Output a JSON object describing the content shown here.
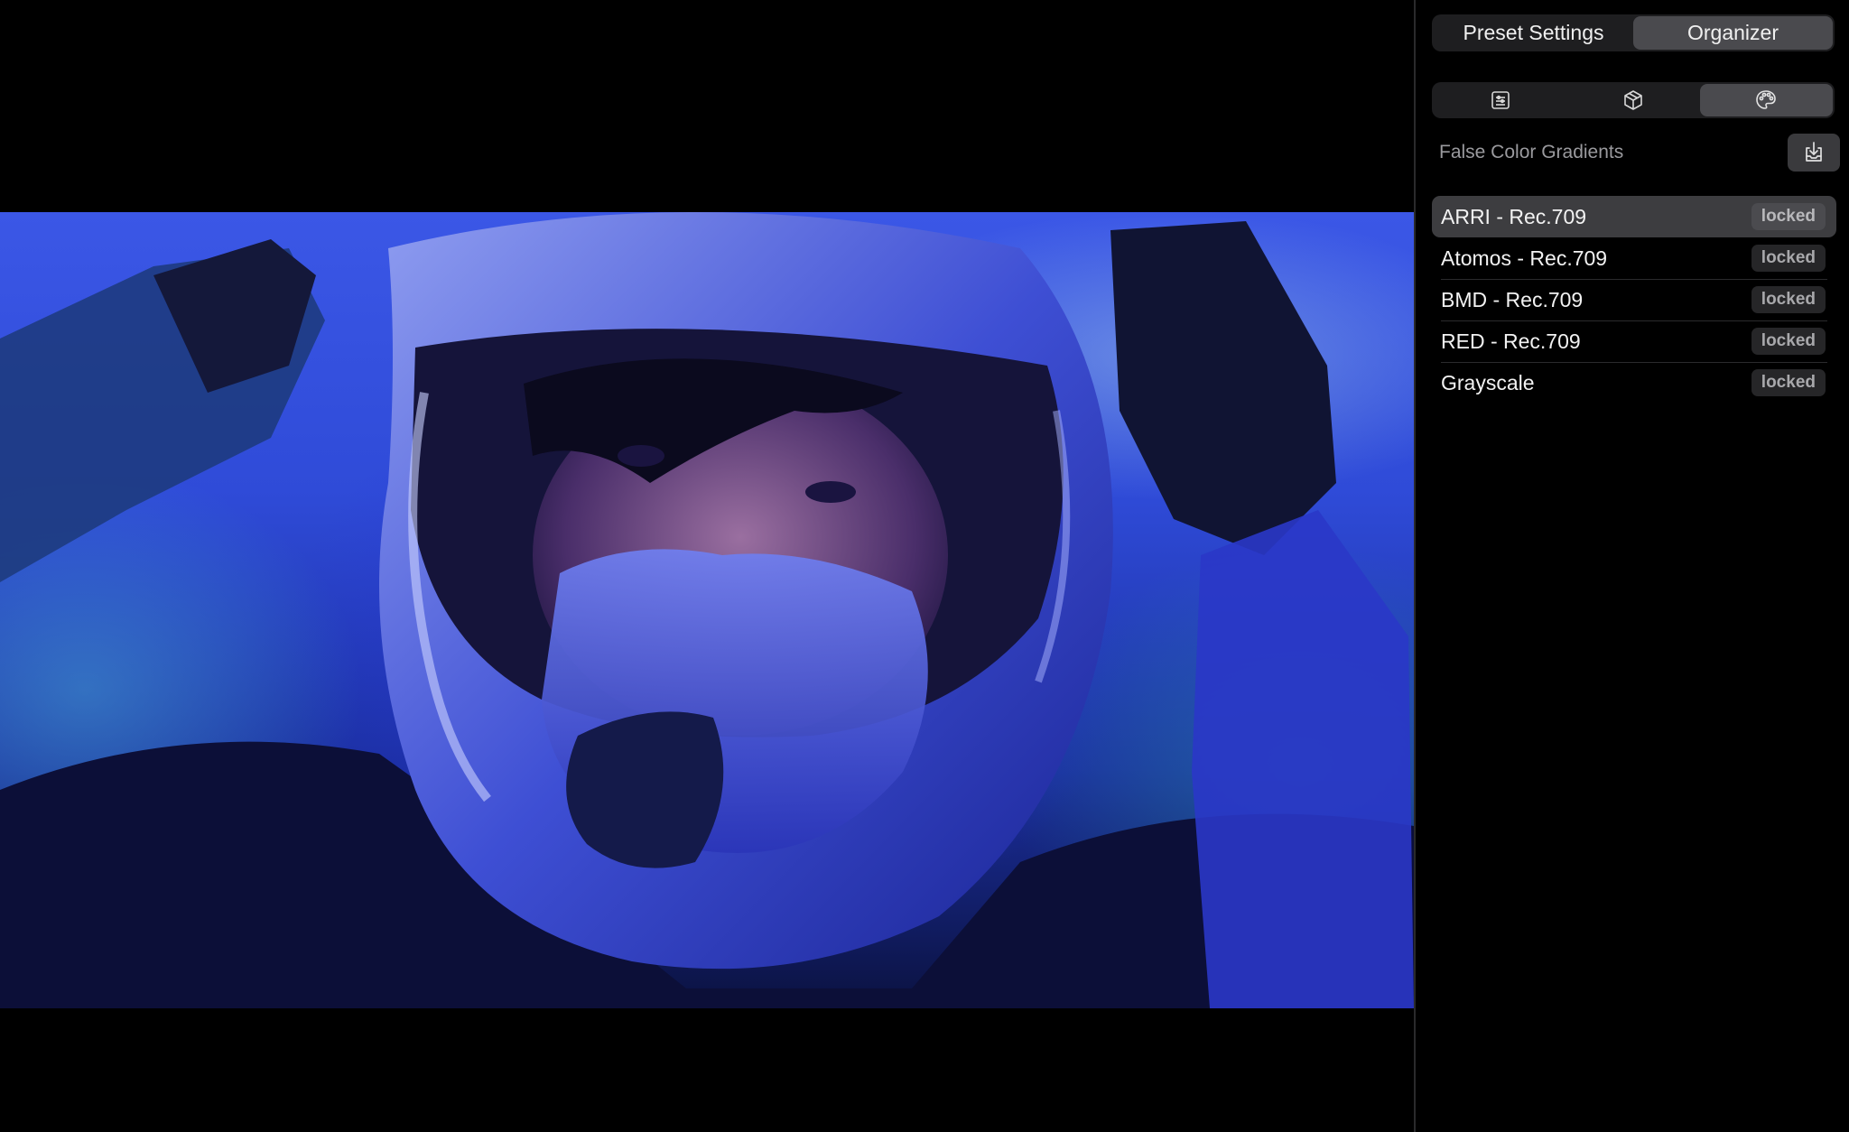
{
  "viewer": {
    "image_description_icon": "photo"
  },
  "tabs": {
    "preset_settings": "Preset Settings",
    "organizer": "Organizer",
    "active": "Organizer"
  },
  "icon_tabs": [
    {
      "icon": "sliders-list-icon",
      "active": false
    },
    {
      "icon": "cube-icon",
      "active": false
    },
    {
      "icon": "palette-icon",
      "active": true
    }
  ],
  "section": {
    "title": "False Color Gradients",
    "import_icon": "import-tray-icon"
  },
  "gradients": [
    {
      "name": "ARRI - Rec.709",
      "badge": "locked",
      "selected": true
    },
    {
      "name": "Atomos - Rec.709",
      "badge": "locked",
      "selected": false
    },
    {
      "name": "BMD - Rec.709",
      "badge": "locked",
      "selected": false
    },
    {
      "name": "RED - Rec.709",
      "badge": "locked",
      "selected": false
    },
    {
      "name": "Grayscale",
      "badge": "locked",
      "selected": false
    }
  ],
  "colors": {
    "background": "#000000",
    "segment_bg": "#1e1e20",
    "segment_active": "#4a4a4e",
    "selected_row": "#3d3d40",
    "badge_bg": "#262628",
    "secondary_text": "#9a9a9e"
  }
}
